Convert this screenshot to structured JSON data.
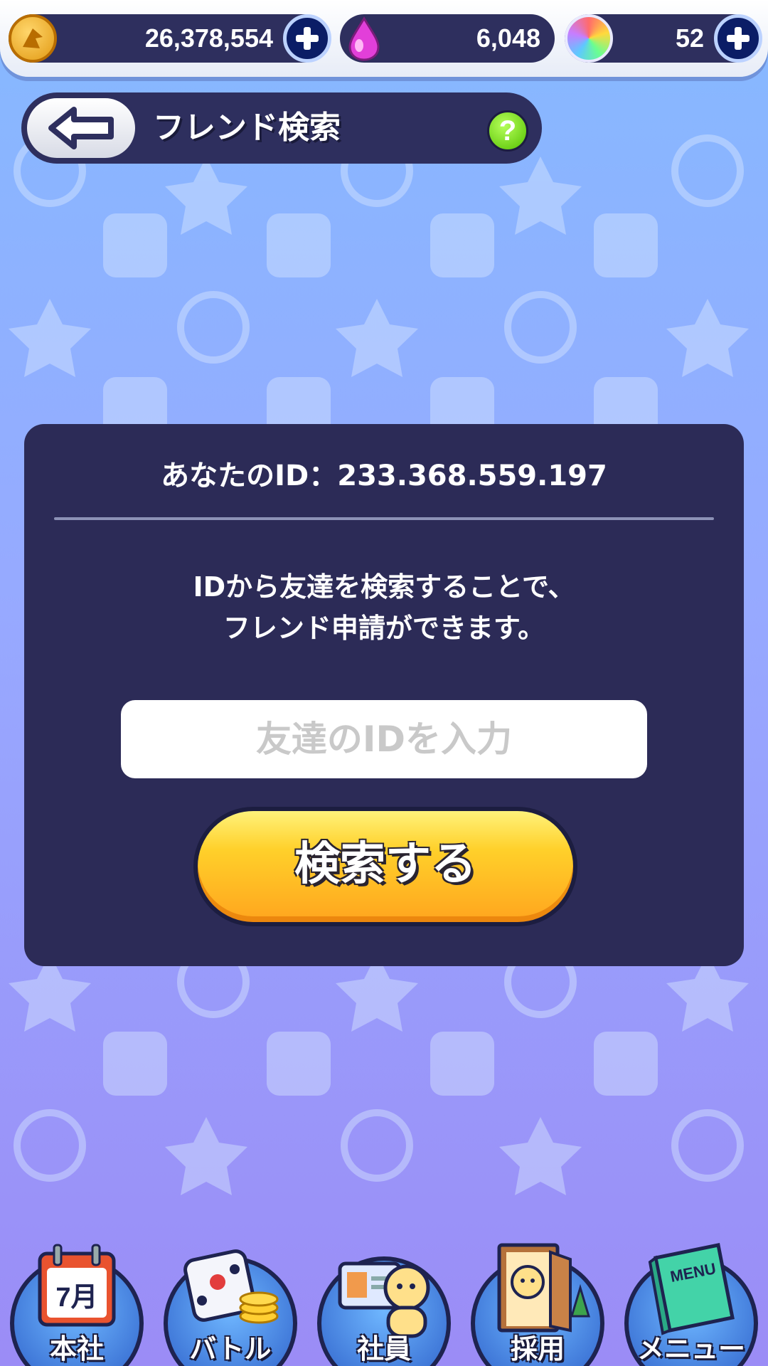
{
  "currencies": [
    {
      "icon": "coin-icon",
      "value": "26,378,554"
    },
    {
      "icon": "pink-drop-icon",
      "value": "6,048"
    },
    {
      "icon": "rainbow-gem-icon",
      "value": "52"
    }
  ],
  "header": {
    "title": "フレンド検索"
  },
  "panel": {
    "id_text": "あなたのID：233.368.559.197",
    "desc_line1": "IDから友達を検索することで、",
    "desc_line2": "フレンド申請ができます。",
    "input_placeholder": "友達のIDを入力",
    "search_button": "検索する"
  },
  "nav": {
    "items": [
      {
        "label": "本社",
        "icon": "calendar-icon",
        "calendar_text": "7月"
      },
      {
        "label": "バトル",
        "icon": "dice-icon"
      },
      {
        "label": "社員",
        "icon": "employee-icon"
      },
      {
        "label": "採用",
        "icon": "door-icon"
      },
      {
        "label": "メニュー",
        "icon": "menu-book-icon",
        "book_text": "MENU"
      }
    ]
  },
  "colors": {
    "panel": "#2c2b57",
    "accent_button": "#ffb21e",
    "help": "#53c000"
  }
}
